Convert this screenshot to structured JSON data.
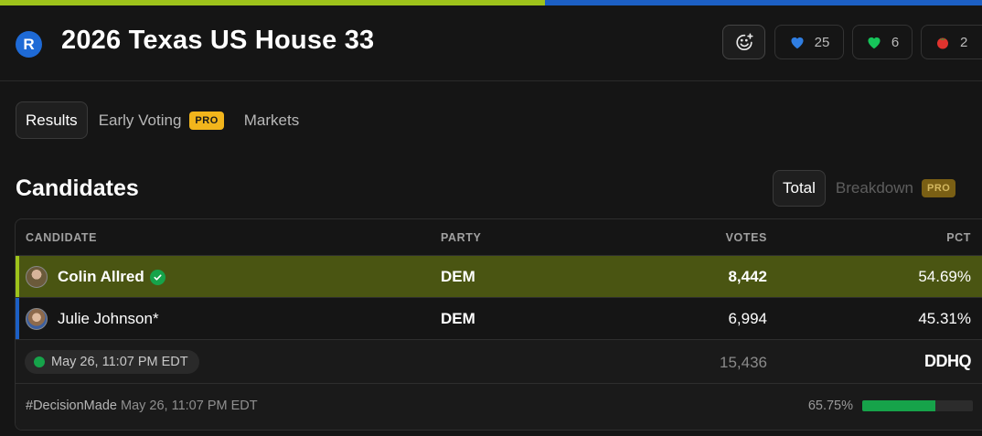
{
  "header": {
    "party_letter": "R",
    "title": "2026 Texas US House 33",
    "reactions": [
      {
        "icon": "blue-heart-icon",
        "count": "25"
      },
      {
        "icon": "green-heart-icon",
        "count": "6"
      },
      {
        "icon": "tomato-icon",
        "count": "2"
      }
    ]
  },
  "tabs": {
    "results": "Results",
    "early_voting": "Early Voting",
    "pro": "PRO",
    "markets": "Markets"
  },
  "section": {
    "title": "Candidates",
    "toggle_total": "Total",
    "toggle_breakdown": "Breakdown",
    "pro": "PRO"
  },
  "table": {
    "columns": [
      "CANDIDATE",
      "PARTY",
      "VOTES",
      "PCT"
    ],
    "rows": [
      {
        "name": "Colin Allred",
        "party": "DEM",
        "votes": "8,442",
        "pct": "54.69%",
        "winner": true
      },
      {
        "name": "Julie Johnson*",
        "party": "DEM",
        "votes": "6,994",
        "pct": "45.31%",
        "winner": false
      }
    ],
    "timestamp": "May 26, 11:07 PM EDT",
    "total_votes": "15,436",
    "source_logo": "DDHQ"
  },
  "footer": {
    "tag": "#DecisionMade",
    "time": "May 26, 11:07 PM EDT",
    "reported_pct": "65.75%",
    "reported_fraction": 0.6575
  },
  "colors": {
    "winner_row": "#4a5512",
    "accent_green": "#9ec31b",
    "accent_blue": "#1c5fc4",
    "pro_yellow": "#f2b51c",
    "progress_green": "#16a34a"
  }
}
